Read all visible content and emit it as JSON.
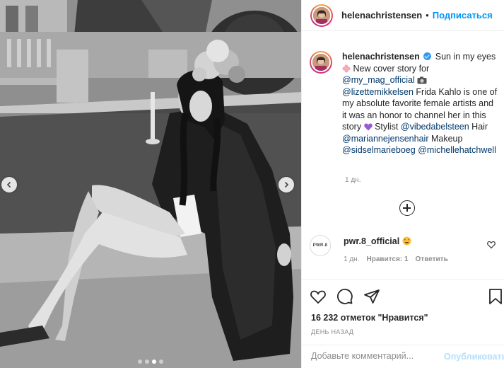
{
  "post": {
    "username": "helenachristensen",
    "separator": "•",
    "follow_label": "Подписаться",
    "caption": {
      "username": "helenachristensen",
      "text_1": "Sun in my eyes",
      "text_2": "New cover story for",
      "tag_1": "@my_mag_official",
      "tag_2": "@lizettemikkelsen",
      "text_3": "Frida Kahlo is one of my absolute favorite female artists and it was an honor to channel her in this story",
      "text_4": "Stylist",
      "tag_3": "@vibedabelsteen",
      "text_5": "Hair",
      "tag_4": "@mariannejensenhair",
      "text_6": "Makeup",
      "tag_5": "@sidselmarieboeg",
      "tag_6": "@michellehatchwell"
    },
    "caption_time": "1 дн.",
    "likes": "16 232 отметок \"Нравится\"",
    "date": "ДЕНЬ НАЗАД"
  },
  "comment": {
    "avatar_text": "PWR.8",
    "username": "pwr.8_official",
    "time": "1 дн.",
    "likes": "Нравится: 1",
    "reply": "Ответить"
  },
  "add_comment": {
    "placeholder": "Добавьте комментарий...",
    "publish": "Опубликовать"
  },
  "carousel": {
    "slides": 4,
    "active_index": 2
  },
  "colors": {
    "link": "#00376b",
    "accent": "#0095f6",
    "verified": "#3897f0"
  },
  "icons": [
    "chevron-left-icon",
    "chevron-right-icon",
    "verified-badge-icon",
    "heart-icon",
    "comment-icon",
    "share-icon",
    "bookmark-icon",
    "plus-circle-icon"
  ]
}
